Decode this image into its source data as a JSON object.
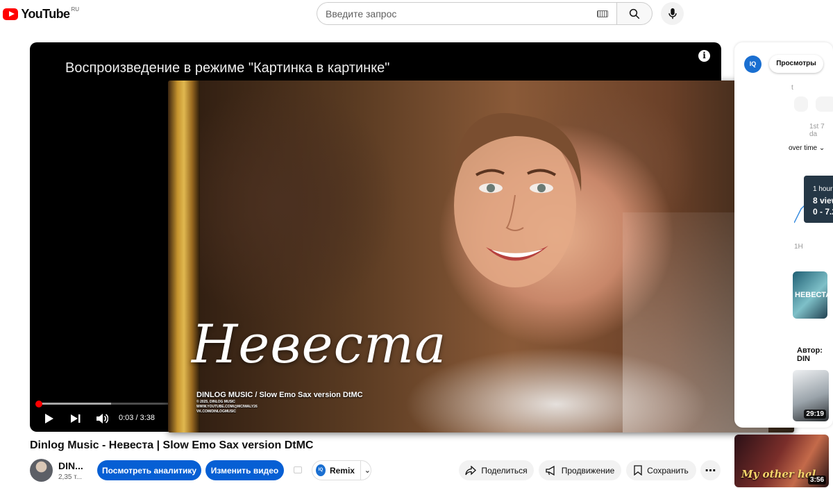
{
  "header": {
    "logo_text": "YouTube",
    "country_code": "RU",
    "search_placeholder": "Введите запрос"
  },
  "player": {
    "pip_message": "Воспроизведение в режиме \"Картинка в картинке\"",
    "time_display": "0:03 / 3:38",
    "progress_fraction": 0.014
  },
  "pip_video": {
    "title_art": "Невеста",
    "subtitle": "DINLOG MUSIC / Slow Emo Sax version DtMC",
    "credits": [
      "© 2025, DINLOG MUSIC",
      "WWW.YOUTUBE.COM/@MCIWALY26",
      "VK.COM/DINLOGMUSIC"
    ]
  },
  "side_panel": {
    "logo_text": "IQ",
    "views_tab": "Просмотры",
    "partial_label_t": "t",
    "first_days": "1st 7 da",
    "over_time": "over time",
    "tooltip": {
      "line1": "1 hour",
      "line2": "8 view",
      "line3": "0 - 7.2"
    },
    "axis_label": "1H",
    "author_label": "Автор: DIN",
    "thumb_duration_1": "29:19",
    "thumb_text_2": "НЕВЕСТА",
    "thumb_duration_3": "3:56",
    "thumb_art_3": "My other hal"
  },
  "video": {
    "title": "Dinlog Music - Невеста | Slow Emo Sax version DtMC",
    "channel_name": "DIN...",
    "subscribers": "2,35 т...",
    "analytics_button": "Посмотреть аналитику",
    "edit_button": "Изменить видео",
    "remix_button": "Remix",
    "remix_logo": "IQ",
    "share_button": "Поделиться",
    "promote_button": "Продвижение",
    "save_button": "Сохранить"
  }
}
